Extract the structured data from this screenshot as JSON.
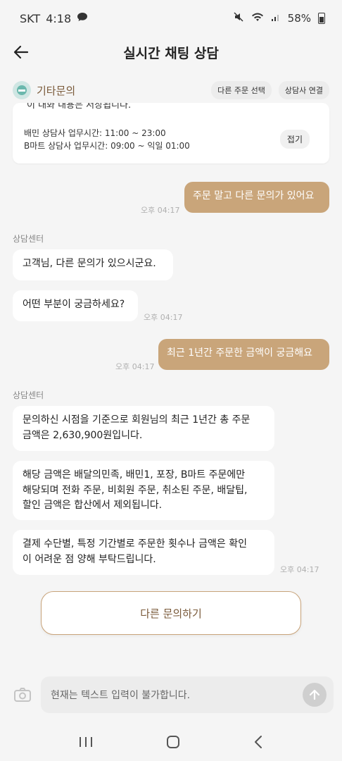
{
  "status_bar": {
    "carrier": "SKT",
    "time": "4:18",
    "battery": "58%"
  },
  "header": {
    "title": "실시간 채팅 상담"
  },
  "sub_header": {
    "title": "기타문의",
    "buttons": [
      "다른 주문 선택",
      "상담사 연결"
    ]
  },
  "notice": {
    "clipped_text": "이 대화 내용은 저장됩니다.",
    "lines": [
      "배민 상담사 업무시간: 11:00 ~ 23:00",
      "B마트 상담사 업무시간: 09:00 ~ 익일 01:00"
    ],
    "fold_label": "접기"
  },
  "messages": {
    "m1": {
      "text": "주문 말고 다른 문의가 있어요",
      "time": "오후 04:17"
    },
    "sender1": "상담센터",
    "m2": {
      "text": "고객님, 다른 문의가 있으시군요."
    },
    "m3": {
      "text": "어떤 부분이 궁금하세요?",
      "time": "오후 04:17"
    },
    "m4": {
      "text": "최근 1년간 주문한 금액이 궁금해요",
      "time": "오후 04:17"
    },
    "sender2": "상담센터",
    "m5": {
      "lines": [
        "문의하신 시점을 기준으로 회원님의 최근 1년간 총 주문",
        "금액은 2,630,900원입니다."
      ]
    },
    "m6": {
      "lines": [
        "해당 금액은 배달의민족, 배민1, 포장, B마트 주문에만",
        "해당되며 전화 주문, 비회원 주문, 취소된 주문, 배달팁,",
        "할인 금액은 합산에서 제외됩니다."
      ]
    },
    "m7": {
      "lines": [
        "결제 수단별, 특정 기간별로 주문한 횟수나 금액은 확인",
        "이 어려운 점 양해 부탁드립니다."
      ],
      "time": "오후 04:17"
    }
  },
  "cta": {
    "label": "다른 문의하기"
  },
  "input": {
    "placeholder": "현재는 텍스트 입력이 불가합니다."
  }
}
